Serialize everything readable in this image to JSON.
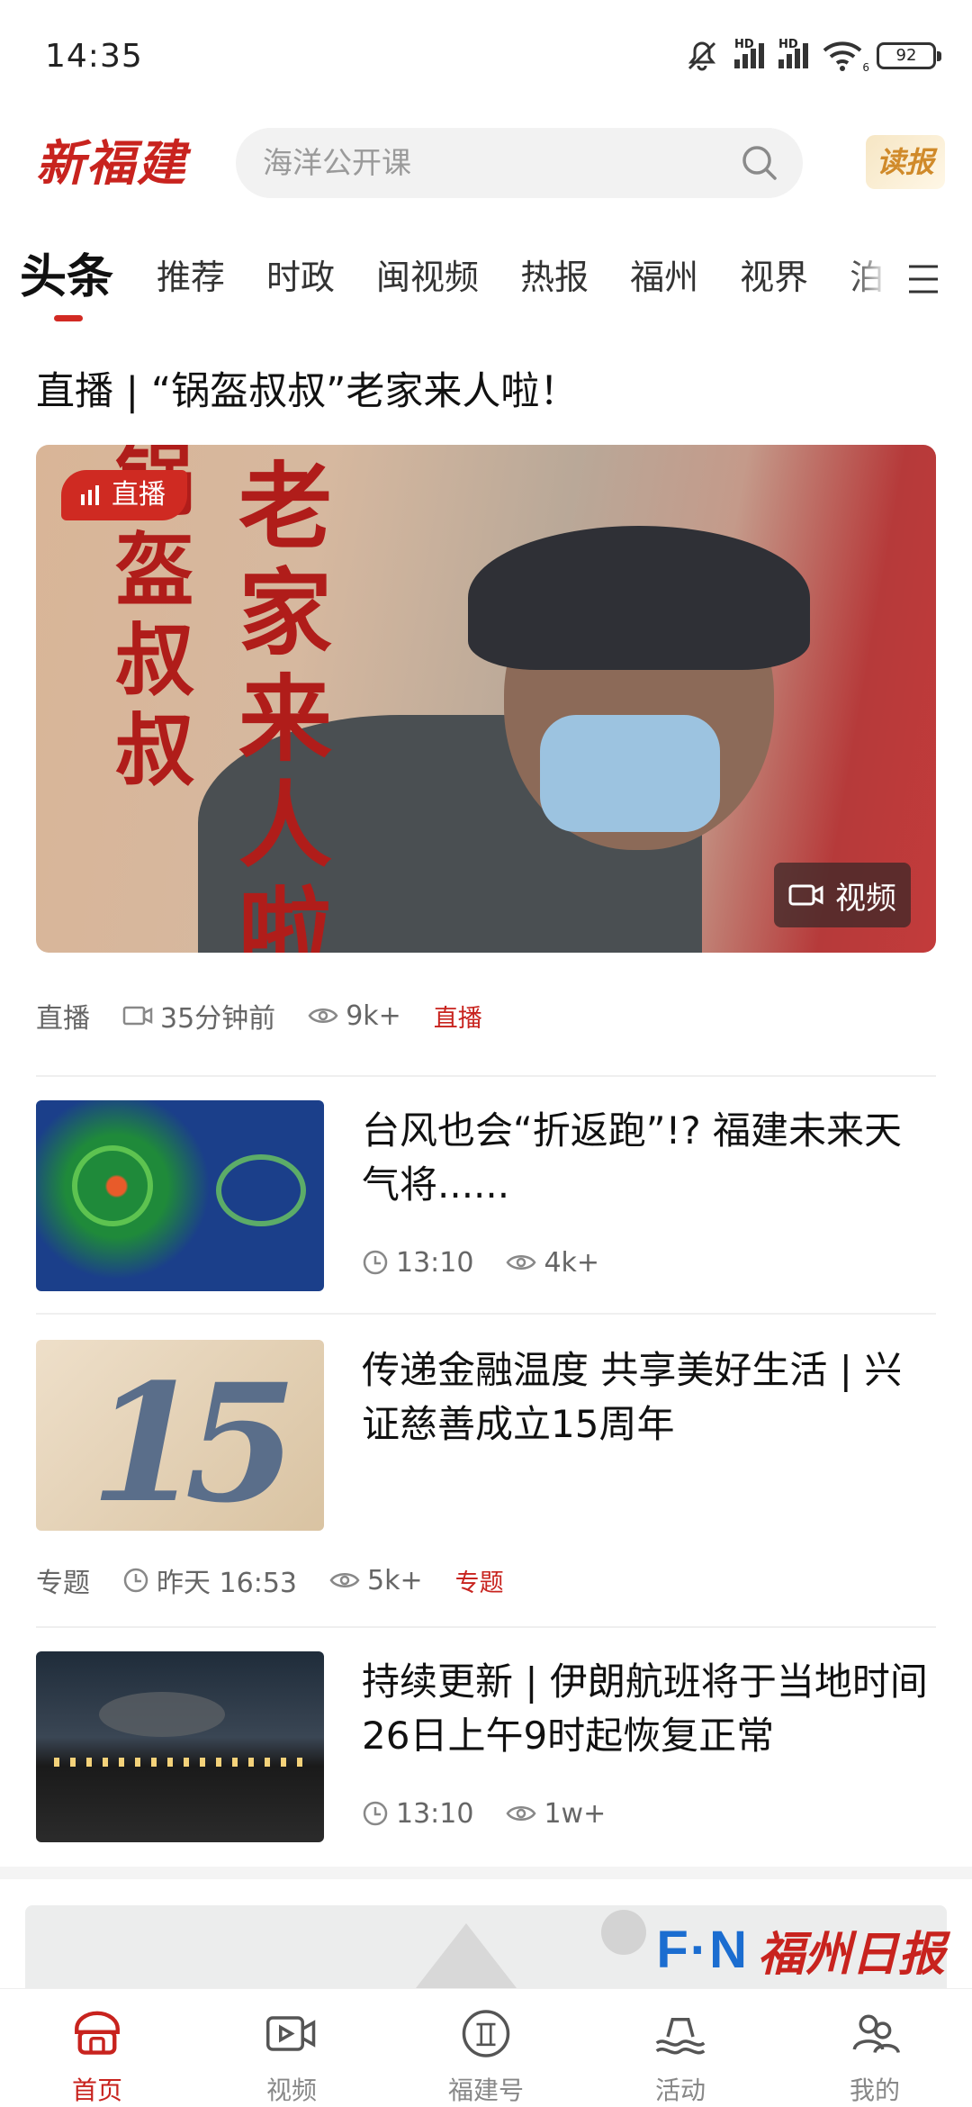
{
  "status_bar": {
    "time": "14:35",
    "signal_1": "HD",
    "signal_2": "HD",
    "wifi_sub": "6",
    "battery": "92"
  },
  "header": {
    "logo": "新福建",
    "search_placeholder": "海洋公开课",
    "read_label": "读报"
  },
  "tabs": [
    "头条",
    "推荐",
    "时政",
    "闽视频",
    "热报",
    "福州",
    "视界",
    "泊"
  ],
  "feature": {
    "title": "直播 | “锅盔叔叔”老家来人啦！",
    "overlay_left": "锅盔叔叔",
    "overlay_right": "老家来人啦",
    "live_badge": "直播",
    "video_badge": "视频",
    "meta": {
      "category": "直播",
      "time": "35分钟前",
      "views": "9k+",
      "tag": "直播"
    }
  },
  "news": [
    {
      "title": "台风也会“折返跑”!? 福建未来天气将......",
      "time": "13:10",
      "views": "4k+"
    },
    {
      "title": "传递金融温度 共享美好生活 | 兴证慈善成立15周年",
      "thumb_text": "15",
      "meta": {
        "category": "专题",
        "time": "昨天 16:53",
        "views": "5k+",
        "tag": "专题"
      }
    },
    {
      "title": "持续更新 | 伊朗航班将于当地时间26日上午9时起恢复正常",
      "time": "13:10",
      "views": "1w+"
    }
  ],
  "banner": {
    "mark": "F·N",
    "name": "福州日报"
  },
  "bottom_nav": [
    {
      "label": "首页",
      "icon": "home-icon",
      "active": true
    },
    {
      "label": "视频",
      "icon": "video-icon",
      "active": false
    },
    {
      "label": "福建号",
      "icon": "fujian-hao-icon",
      "active": false
    },
    {
      "label": "活动",
      "icon": "activity-icon",
      "active": false
    },
    {
      "label": "我的",
      "icon": "profile-icon",
      "active": false
    }
  ],
  "colors": {
    "brand_red": "#c8231e",
    "fn_blue": "#1b6dd0"
  }
}
